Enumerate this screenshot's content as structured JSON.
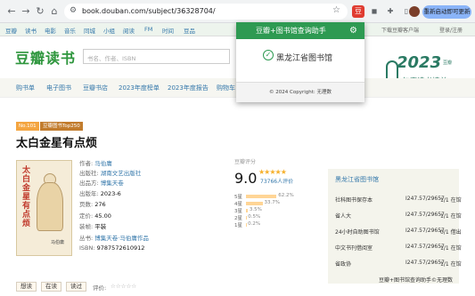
{
  "browser": {
    "url": "book.douban.com/subject/36328704/",
    "update_button": "重新启动即可更新"
  },
  "topnav": {
    "items": [
      "豆瓣",
      "读书",
      "电影",
      "音乐",
      "同城",
      "小组",
      "阅读",
      "FM",
      "时间",
      "豆品"
    ],
    "download": "下载豆瓣客户端",
    "login": "登录/注册"
  },
  "site": {
    "logo": "豆瓣读书",
    "search_placeholder": "书名、作者、ISBN"
  },
  "subnav": {
    "items": [
      "购书单",
      "电子图书",
      "豆瓣书店",
      "2023年度榜单",
      "2023年度报告",
      "购物车"
    ]
  },
  "banner": {
    "year": "2023",
    "small": "豆瓣",
    "tagline": "年度读书榜单"
  },
  "popup": {
    "title": "豆瓣+图书馆查询助手",
    "library": "黑龙江省图书馆",
    "footer": "© 2024 Copyright: 无理数"
  },
  "book": {
    "badge_no": "No.101",
    "badge_top": "豆瓣图书Top250",
    "title": "太白金星有点烦",
    "cover_title": "太白金星有点烦",
    "cover_author": "马伯庸",
    "info": [
      {
        "label": "作者:",
        "value": "马伯庸",
        "link": true
      },
      {
        "label": "出版社:",
        "value": "湖南文艺出版社",
        "link": true
      },
      {
        "label": "出品方:",
        "value": "博集天卷",
        "link": true
      },
      {
        "label": "出版年:",
        "value": "2023-6",
        "link": false
      },
      {
        "label": "页数:",
        "value": "276",
        "link": false
      },
      {
        "label": "定价:",
        "value": "45.00",
        "link": false
      },
      {
        "label": "装帧:",
        "value": "平装",
        "link": false
      },
      {
        "label": "丛书:",
        "value": "博集天卷·马伯庸作品",
        "link": true
      },
      {
        "label": "ISBN:",
        "value": "9787572610912",
        "link": false
      }
    ]
  },
  "rating": {
    "label": "豆瓣评分",
    "score": "9.0",
    "stars": "★★★★★",
    "count": "73766人评价",
    "bars": [
      {
        "star": "5星",
        "pct": "62.2%",
        "value": 62.2
      },
      {
        "star": "4星",
        "pct": "33.7%",
        "value": 33.7
      },
      {
        "star": "3星",
        "pct": "3.5%",
        "value": 3.5
      },
      {
        "star": "2星",
        "pct": "0.5%",
        "value": 0.5
      },
      {
        "star": "1星",
        "pct": "0.2%",
        "value": 0.2
      }
    ]
  },
  "actions": {
    "want": "想读",
    "reading": "在读",
    "read": "读过",
    "rate_label": "评价:",
    "rate_stars": "☆☆☆☆☆"
  },
  "library_panel": {
    "title": "黑龙江省图书馆",
    "rows": [
      {
        "place": "社科图书保存本",
        "call": "I247.57/29657",
        "status": "1/1 在馆"
      },
      {
        "place": "省人大",
        "call": "I247.57/29657",
        "status": "1/1 在馆"
      },
      {
        "place": "24小时自助图书馆",
        "call": "I247.57/29657",
        "status": "0/1 借出"
      },
      {
        "place": "中文书刊借阅室",
        "call": "I247.57/29657",
        "status": "1/1 在馆"
      },
      {
        "place": "省政协",
        "call": "I247.57/29657",
        "status": "1/1 在馆"
      }
    ],
    "footer": "豆瓣+图书馆查询助手©无理数"
  }
}
